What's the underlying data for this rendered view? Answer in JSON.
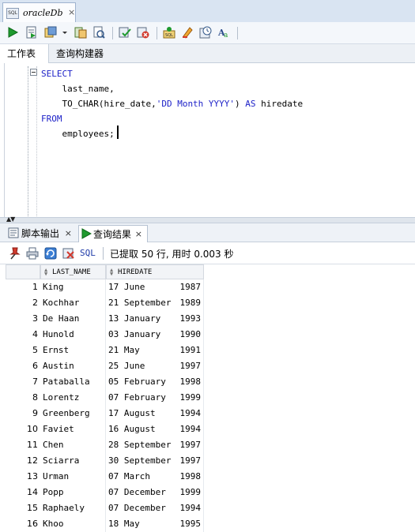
{
  "document_tab": {
    "badge": "SQL",
    "title": "oracleDb",
    "close": "×"
  },
  "worksheet_tabs": [
    "工作表",
    "查询构建器"
  ],
  "editor": {
    "lines": [
      {
        "parts": [
          {
            "t": "SELECT",
            "c": "kw"
          }
        ]
      },
      {
        "parts": [
          {
            "t": "    last_name,",
            "c": ""
          }
        ]
      },
      {
        "parts": [
          {
            "t": "    TO_CHAR(hire_date,",
            "c": ""
          },
          {
            "t": "'DD Month YYYY'",
            "c": "str"
          },
          {
            "t": ") ",
            "c": ""
          },
          {
            "t": "AS",
            "c": "kw"
          },
          {
            "t": " hiredate",
            "c": ""
          }
        ]
      },
      {
        "parts": [
          {
            "t": "FROM",
            "c": "kw"
          }
        ]
      },
      {
        "parts": [
          {
            "t": "    employees;",
            "c": ""
          }
        ]
      }
    ]
  },
  "output_tabs": {
    "script_output": "脚本输出",
    "query_result": "查询结果",
    "close": "×"
  },
  "results_toolbar": {
    "sql_label": "SQL",
    "status": "已提取 50 行, 用时 0.003 秒"
  },
  "grid": {
    "columns": [
      "LAST_NAME",
      "HIREDATE"
    ],
    "rows": [
      {
        "n": "1",
        "last_name": "King",
        "date": "17 June",
        "year": "1987"
      },
      {
        "n": "2",
        "last_name": "Kochhar",
        "date": "21 September",
        "year": "1989"
      },
      {
        "n": "3",
        "last_name": "De Haan",
        "date": "13 January",
        "year": "1993"
      },
      {
        "n": "4",
        "last_name": "Hunold",
        "date": "03 January",
        "year": "1990"
      },
      {
        "n": "5",
        "last_name": "Ernst",
        "date": "21 May",
        "year": "1991"
      },
      {
        "n": "6",
        "last_name": "Austin",
        "date": "25 June",
        "year": "1997"
      },
      {
        "n": "7",
        "last_name": "Pataballa",
        "date": "05 February",
        "year": "1998"
      },
      {
        "n": "8",
        "last_name": "Lorentz",
        "date": "07 February",
        "year": "1999"
      },
      {
        "n": "9",
        "last_name": "Greenberg",
        "date": "17 August",
        "year": "1994"
      },
      {
        "n": "10",
        "last_name": "Faviet",
        "date": "16 August",
        "year": "1994"
      },
      {
        "n": "11",
        "last_name": "Chen",
        "date": "28 September",
        "year": "1997"
      },
      {
        "n": "12",
        "last_name": "Sciarra",
        "date": "30 September",
        "year": "1997"
      },
      {
        "n": "13",
        "last_name": "Urman",
        "date": "07 March",
        "year": "1998"
      },
      {
        "n": "14",
        "last_name": "Popp",
        "date": "07 December",
        "year": "1999"
      },
      {
        "n": "15",
        "last_name": "Raphaely",
        "date": "07 December",
        "year": "1994"
      },
      {
        "n": "16",
        "last_name": "Khoo",
        "date": "18 May",
        "year": "1995"
      }
    ]
  },
  "toolbar_icons": [
    "run-statement-icon",
    "run-script-icon",
    "autotrace-icon",
    "dropdown-arrow-icon",
    "explain-plan-icon",
    "sql-tuning-icon",
    "commit-icon",
    "rollback-icon",
    "unshared-sql-icon",
    "clear-icon",
    "sql-history-icon",
    "format-icon"
  ],
  "colors": {
    "keyword": "#1e22c8",
    "run_green": "#1f9a2e"
  }
}
